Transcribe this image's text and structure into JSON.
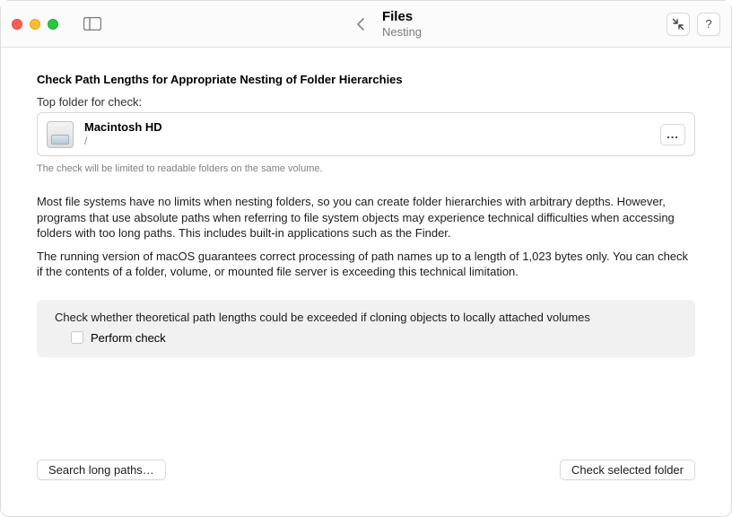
{
  "titlebar": {
    "title": "Files",
    "subtitle": "Nesting"
  },
  "main": {
    "heading": "Check Path Lengths for Appropriate Nesting of Folder Hierarchies",
    "top_folder_label": "Top folder for check:",
    "folder": {
      "name": "Macintosh HD",
      "path": "/"
    },
    "ellipsis": "...",
    "hint": "The check will be limited to readable folders on the same volume.",
    "paragraph1": "Most file systems have no limits when nesting folders, so you can create folder hierarchies with arbitrary depths. However, programs that use absolute paths when referring to file system objects may experience technical difficulties when accessing folders with too long paths. This includes built-in applications such as the Finder.",
    "paragraph2": "The running version of macOS guarantees correct processing of path names up to a length of 1,023 bytes only. You can check if the contents of a folder, volume, or mounted file server is exceeding this technical limitation.",
    "option_heading": "Check whether theoretical path lengths could be exceeded if cloning objects to locally attached volumes",
    "option_checkbox_label": "Perform check"
  },
  "buttons": {
    "search": "Search long paths…",
    "check": "Check selected folder",
    "help": "?"
  }
}
